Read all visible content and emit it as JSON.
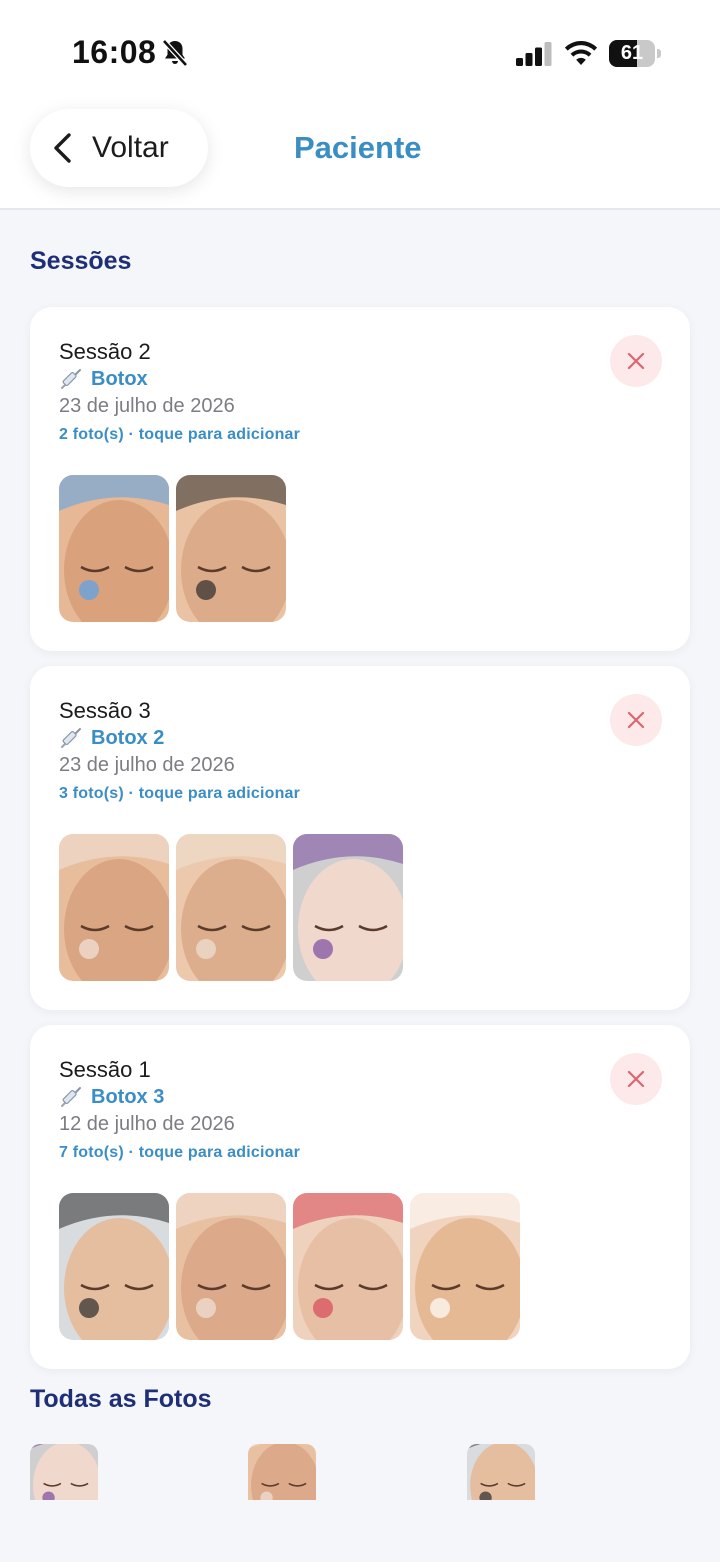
{
  "status_bar": {
    "time": "16:08",
    "battery": "61",
    "battery_level": 0.61
  },
  "header": {
    "back_label": "Voltar",
    "title": "Paciente"
  },
  "sessions_title": "Sessões",
  "sessions": [
    {
      "title": "Sessão 2",
      "procedure": "Botox",
      "date": "23 de julho de 2026",
      "photo_count": "2 foto(s) · toque para adicionar",
      "photos": [
        {
          "bg": "#e6b896",
          "tone": "#d9a17c",
          "accent": "#55a4ee"
        },
        {
          "bg": "#e9c3a3",
          "tone": "#dcab89",
          "accent": "#2b2b2b"
        }
      ]
    },
    {
      "title": "Sessão 3",
      "procedure": "Botox 2",
      "date": "23 de julho de 2026",
      "photo_count": "3 foto(s) · toque para adicionar",
      "photos": [
        {
          "bg": "#e7bd9c",
          "tone": "#d9a583",
          "accent": "#f2e4dc"
        },
        {
          "bg": "#ecc9ad",
          "tone": "#ddae8e",
          "accent": "#efe1d6"
        },
        {
          "bg": "#cfcfcf",
          "tone": "#f0d9cc",
          "accent": "#7a4aa0"
        }
      ]
    },
    {
      "title": "Sessão 1",
      "procedure": "Botox 3",
      "date": "12 de julho de 2026",
      "photo_count": "7 foto(s) · toque para adicionar",
      "photos": [
        {
          "bg": "#d9dcdf",
          "tone": "#e5bea0",
          "accent": "#2b2b2b"
        },
        {
          "bg": "#e8c1a2",
          "tone": "#dca98a",
          "accent": "#f1e2d8"
        },
        {
          "bg": "#efd2bd",
          "tone": "#e7bfa4",
          "accent": "#d9485a"
        },
        {
          "bg": "#f1d4bf",
          "tone": "#e6b995",
          "accent": "#ffffff"
        }
      ]
    }
  ],
  "all_photos_title": "Todas as Fotos",
  "all_photos": [
    {
      "bg": "#cfcfcf",
      "tone": "#f0d9cc",
      "accent": "#7a4aa0"
    },
    {
      "bg": "#e8c1a2",
      "tone": "#dca98a",
      "accent": "#f1e2d8"
    },
    {
      "bg": "#d9dcdf",
      "tone": "#e5bea0",
      "accent": "#2b2b2b"
    }
  ],
  "colors": {
    "accent_blue": "#3a8ec4",
    "section_navy": "#1e2f78",
    "delete_bg": "#fde9ea",
    "delete_icon": "#d9676e"
  },
  "icons": {
    "back": "chevron-left-icon",
    "delete": "close-icon",
    "procedure": "syringe-icon",
    "mute": "bell-slash-icon"
  }
}
